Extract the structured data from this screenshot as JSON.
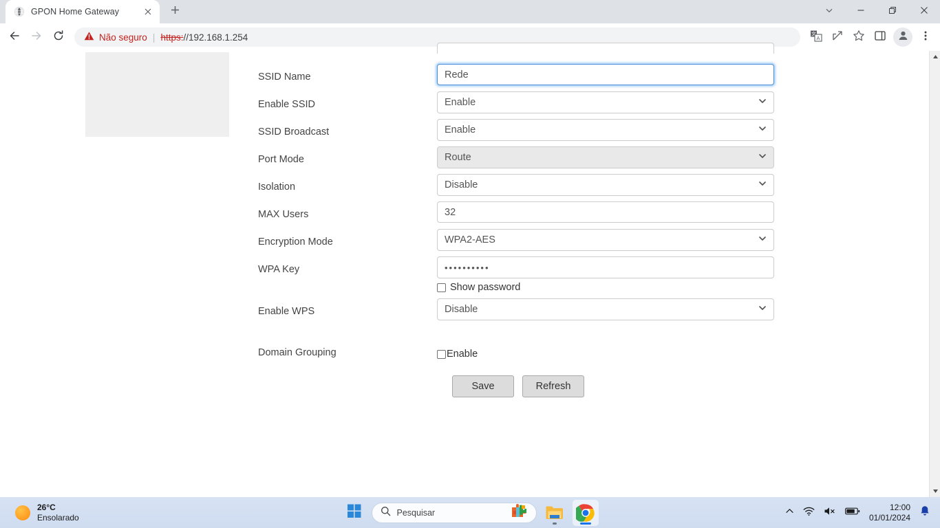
{
  "browser": {
    "tab": {
      "title": "GPON Home Gateway",
      "favicon_icon": "globe-icon",
      "close_icon": "close-icon"
    },
    "new_tab_icon": "plus-icon",
    "window_controls": {
      "tab_search_icon": "chevron-down-icon",
      "minimize_icon": "minimize-icon",
      "maximize_icon": "restore-icon",
      "close_icon": "close-icon"
    },
    "toolbar": {
      "back_icon": "back-arrow-icon",
      "forward_icon": "forward-arrow-icon",
      "reload_icon": "reload-icon",
      "security_icon": "warning-triangle-icon",
      "security_label": "Não seguro",
      "separator": "|",
      "url_scheme": "https:",
      "url_rest": "//192.168.1.254",
      "translate_icon": "translate-icon",
      "share_icon": "share-icon",
      "bookmark_icon": "star-icon",
      "side_panel_icon": "side-panel-icon",
      "profile_icon": "profile-avatar-icon",
      "menu_icon": "three-dots-menu-icon"
    }
  },
  "page": {
    "form_rows": [
      {
        "label": "SSID Name",
        "type": "text",
        "value": "Rede",
        "focused": true,
        "disabled": false
      },
      {
        "label": "Enable SSID",
        "type": "select",
        "value": "Enable",
        "focused": false,
        "disabled": false
      },
      {
        "label": "SSID Broadcast",
        "type": "select",
        "value": "Enable",
        "focused": false,
        "disabled": false
      },
      {
        "label": "Port Mode",
        "type": "select",
        "value": "Route",
        "focused": false,
        "disabled": true
      },
      {
        "label": "Isolation",
        "type": "select",
        "value": "Disable",
        "focused": false,
        "disabled": false
      },
      {
        "label": "MAX Users",
        "type": "text",
        "value": "32",
        "focused": false,
        "disabled": false
      },
      {
        "label": "Encryption Mode",
        "type": "select",
        "value": "WPA2-AES",
        "focused": false,
        "disabled": false
      },
      {
        "label": "WPA Key",
        "type": "password",
        "value": "••••••••••",
        "focused": false,
        "disabled": false
      },
      {
        "label": "Enable WPS",
        "type": "select",
        "value": "Disable",
        "focused": false,
        "disabled": false
      }
    ],
    "show_password": {
      "label": "Show password",
      "checked": false
    },
    "domain_grouping": {
      "label": "Domain Grouping",
      "checkbox_label": "Enable",
      "checked": false
    },
    "buttons": {
      "save": "Save",
      "refresh": "Refresh"
    },
    "scrollbar": {
      "up_icon": "scroll-up-arrow-icon",
      "down_icon": "scroll-down-arrow-icon"
    },
    "colors": {
      "focus_ring": "#4a90d9",
      "disabled_bg": "#e9e9e9",
      "button_bg": "#dcdcdc"
    }
  },
  "taskbar": {
    "weather": {
      "icon": "sun-icon",
      "temperature": "26°C",
      "condition": "Ensolarado"
    },
    "start_icon": "windows-start-icon",
    "search": {
      "icon": "search-icon",
      "placeholder": "Pesquisar"
    },
    "apps": [
      {
        "name": "widgets-puzzle-icon",
        "active": false
      },
      {
        "name": "file-explorer-icon",
        "active": true
      },
      {
        "name": "google-chrome-icon",
        "active": true
      }
    ],
    "tray": {
      "overflow_icon": "chevron-up-icon",
      "wifi_icon": "wifi-icon",
      "volume_icon": "speaker-muted-icon",
      "battery_icon": "battery-icon",
      "time": "12:00",
      "date": "01/01/2024",
      "notification_icon": "bell-icon"
    }
  }
}
